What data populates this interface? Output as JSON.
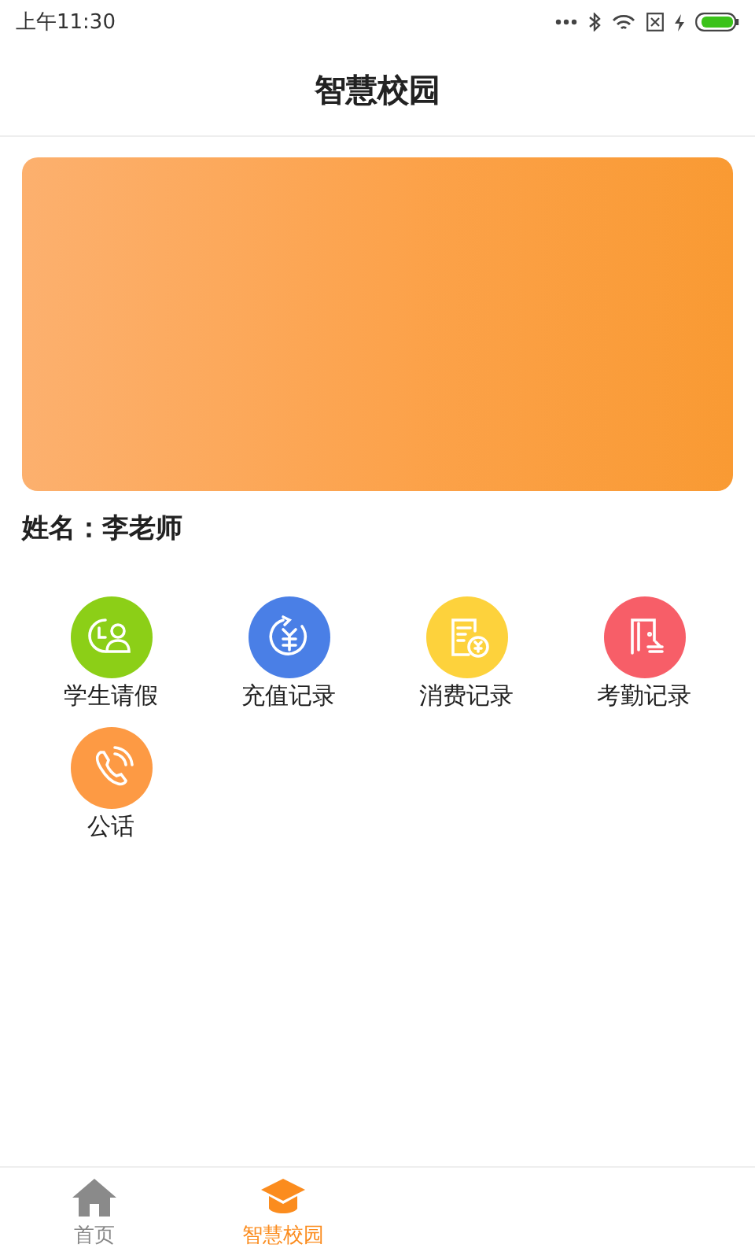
{
  "status_bar": {
    "time": "上午11:30"
  },
  "header": {
    "title": "智慧校园"
  },
  "profile": {
    "name": "姓名：李老师"
  },
  "menu": [
    {
      "label": "学生请假",
      "kind": "leave",
      "color": "#8ccf17"
    },
    {
      "label": "充值记录",
      "kind": "recharge",
      "color": "#4a7fe6"
    },
    {
      "label": "消费记录",
      "kind": "expense",
      "color": "#fdd23c"
    },
    {
      "label": "考勤记录",
      "kind": "attendance",
      "color": "#f75e68"
    },
    {
      "label": "公话",
      "kind": "phone",
      "color": "#fd9a44"
    }
  ],
  "tab_bar": [
    {
      "label": "首页",
      "kind": "home",
      "selected": false
    },
    {
      "label": "智慧校园",
      "kind": "campus",
      "selected": true
    }
  ]
}
